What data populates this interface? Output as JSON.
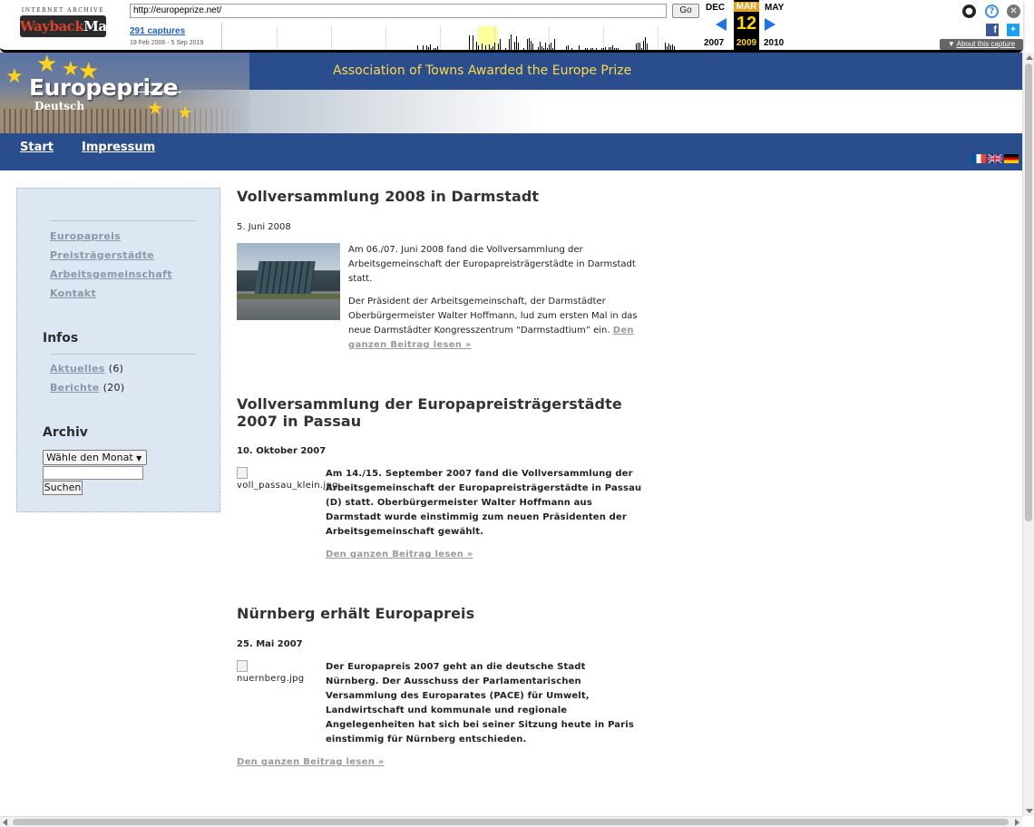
{
  "wayback": {
    "logo_top": "INTERNET ARCHIVE",
    "logo_main_a": "Wayback",
    "logo_main_b": "Machine",
    "url": "http://europeprize.net/",
    "go_label": "Go",
    "captures": "291 captures",
    "range": "19 Feb 2006 - 5 Sep 2019",
    "prev_month": "DEC",
    "cur_month": "MAR",
    "next_month": "MAY",
    "cur_day": "12",
    "prev_year": "2007",
    "cur_year": "2009",
    "next_year": "2010",
    "about": "About this capture"
  },
  "header": {
    "tagline": "Association of Towns Awarded the Europe Prize",
    "title": "Europeprize",
    "subtitle": "Deutsch",
    "accent": "#2a4d8e"
  },
  "nav": {
    "start": "Start",
    "impressum": "Impressum"
  },
  "sidebar": {
    "links": [
      {
        "label": "Europapreis"
      },
      {
        "label": "Preisträgerstädte"
      },
      {
        "label": "Arbeitsgemeinschaft"
      },
      {
        "label": "Kontakt"
      }
    ],
    "infos_heading": "Infos",
    "infos": [
      {
        "label": "Aktuelles",
        "count": "(6)"
      },
      {
        "label": "Berichte",
        "count": "(20)"
      }
    ],
    "archiv_heading": "Archiv",
    "month_select": "Wähle den Monat",
    "search_button": "Suchen"
  },
  "posts": [
    {
      "title": "Vollversammlung 2008 in Darmstadt",
      "date": "5. Juni 2008",
      "p1": "Am 06./07. Juni 2008 fand die Vollversammlung der Arbeitsgemeinschaft der Europapreisträgerstädte in Darmstadt statt.",
      "p2": "Der Präsident der Arbeitsgemeinschaft, der Darmstädter Oberbürgermeister Walter Hoffmann, lud zum ersten Mal in das neue Darmstädter Kongresszentrum “Darmstadtium” ein.",
      "more": "Den ganzen Beitrag lesen »"
    },
    {
      "title": "Vollversammlung der Europapreisträgerstädte 2007 in Passau",
      "date": "10. Oktober 2007",
      "img_alt": "voll_passau_klein.jpg",
      "p1": "Am 14./15. September 2007 fand die Vollversammlung der Arbeitsgemeinschaft der Europapreisträgerstädte in Passau (D) statt. Oberbürgermeister Walter Hoffmann aus Darmstadt wurde einstimmig zum neuen Präsidenten der Arbeitsgemeinschaft gewählt.",
      "more": "Den ganzen Beitrag lesen »"
    },
    {
      "title": "Nürnberg erhält Europapreis",
      "date": "25. Mai 2007",
      "img_alt": "nuernberg.jpg",
      "p1": "Der Europapreis 2007 geht an die deutsche Stadt Nürnberg. Der Ausschuss der Parlamentarischen Versammlung des Europarates (PACE) für Umwelt, Landwirtschaft und kommunale und regionale Angelegenheiten hat sich bei seiner Sitzung heute in Paris einstimmig für Nürnberg entschieden.",
      "more": "Den ganzen Beitrag lesen »"
    }
  ]
}
